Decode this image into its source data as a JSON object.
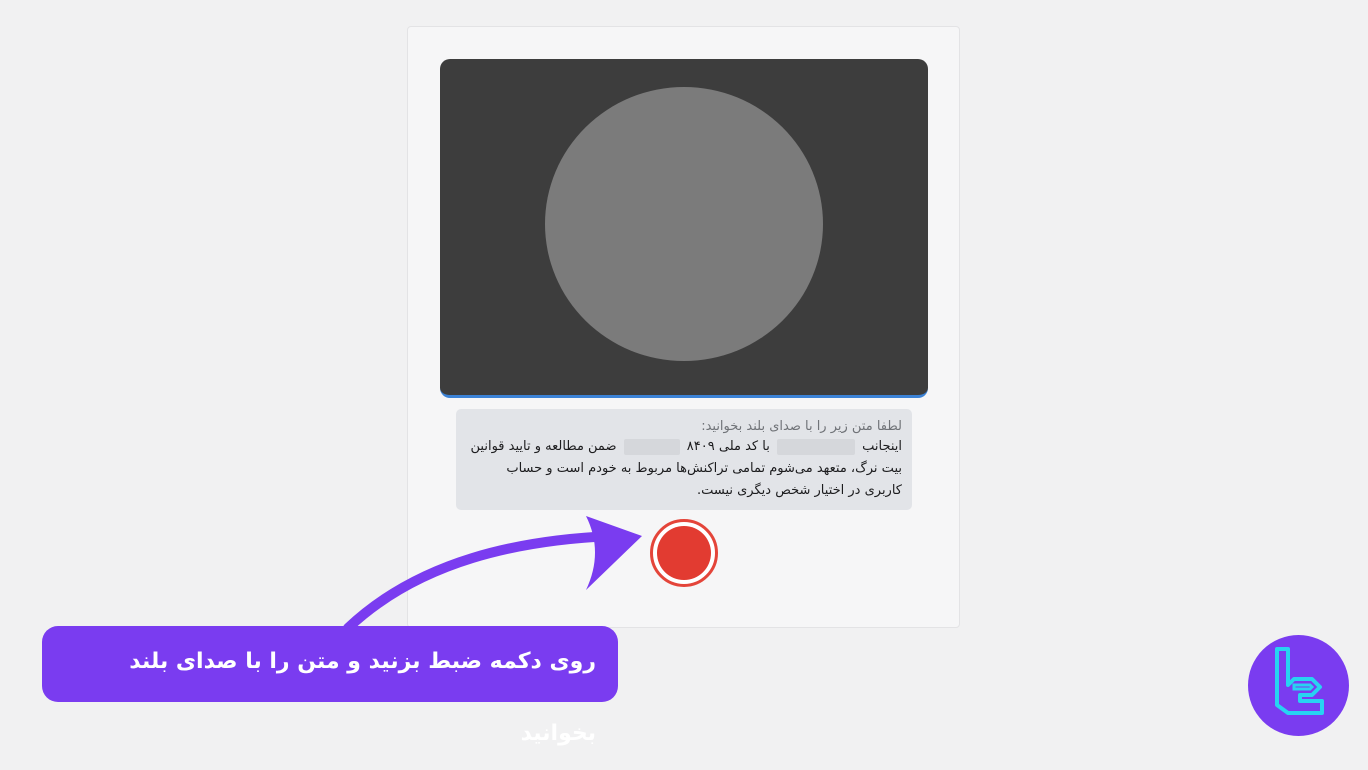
{
  "verification": {
    "instruction": "لطفا متن زیر را با صدای بلند بخوانید:",
    "statement_part1": "اینجانب",
    "statement_part2": "با کد ملی",
    "statement_code_suffix": "۸۴۰۹",
    "statement_part3": "ضمن مطالعه و تایید قوانین بیت نرگ، متعهد می‌شوم تمامی تراکنش‌ها مربوط به خودم است و حساب کاربری در اختیار شخص دیگری نیست."
  },
  "record_button": {
    "color": "#e23b31"
  },
  "callout": {
    "text": "روی دکمه ضبط بزنید و متن را با صدای بلند بخوانید",
    "color": "#7a3cf0"
  },
  "logo": {
    "icon": "tradingfinder-logo-icon",
    "color": "#7a3cf0",
    "accent": "#27d3f2"
  }
}
